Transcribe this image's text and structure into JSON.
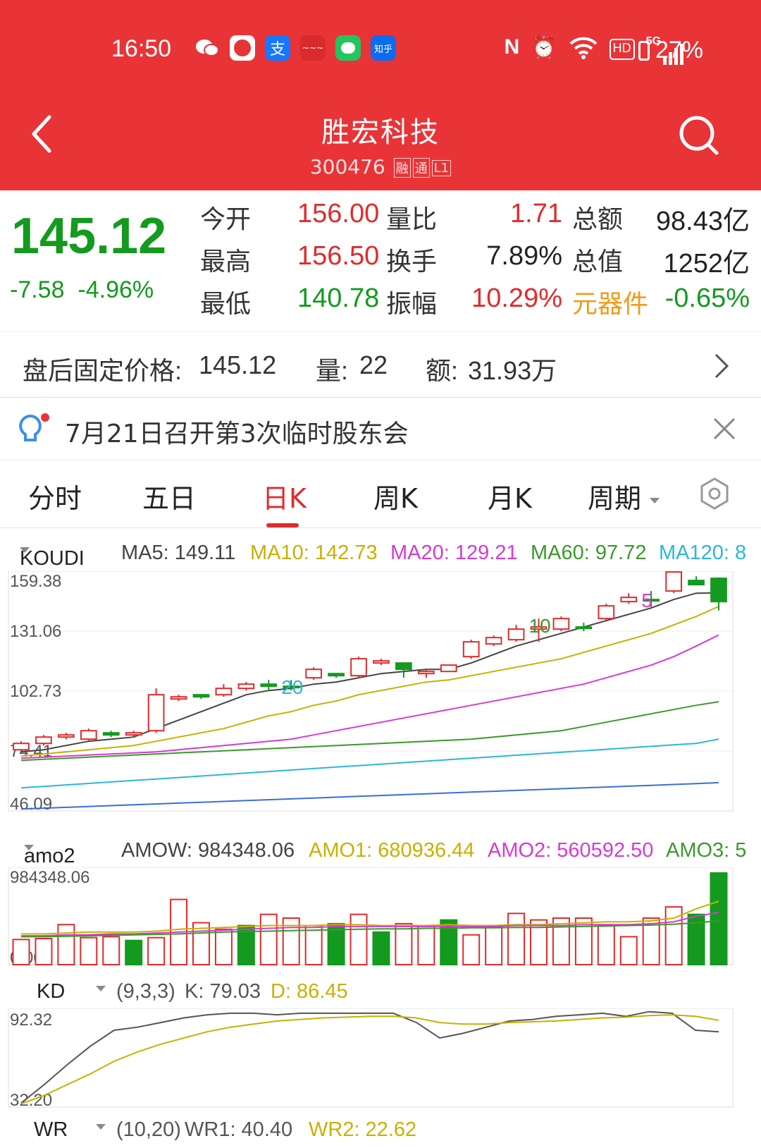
{
  "status_bar": {
    "time": "16:50",
    "battery": "27%",
    "icons": [
      "wechat-icon",
      "app-icon",
      "alipay-icon",
      "app-icon",
      "messages-icon",
      "zhihu-icon",
      "nfc-icon",
      "alarm-icon",
      "wifi-icon",
      "hd-icon",
      "5g-signal-icon",
      "battery-icon"
    ],
    "zhihu_label": "知乎",
    "hd_label": "HD",
    "net_label": "5G"
  },
  "header": {
    "title": "胜宏科技",
    "code": "300476",
    "tags": [
      "融",
      "通",
      "L1"
    ]
  },
  "quote": {
    "price": "145.12",
    "change": "-7.58",
    "change_pct": "-4.96%",
    "open_label": "今开",
    "open": "156.00",
    "high_label": "最高",
    "high": "156.50",
    "low_label": "最低",
    "low": "140.78",
    "vol_ratio_label": "量比",
    "vol_ratio": "1.71",
    "turnover_label": "换手",
    "turnover": "7.89%",
    "amplitude_label": "振幅",
    "amplitude": "10.29%",
    "amount_label": "总额",
    "amount": "98.43亿",
    "mktcap_label": "总值",
    "mktcap": "1252亿",
    "sector_label": "元器件",
    "sector_change": "-0.65%",
    "colors": {
      "up": "#e02b2b",
      "down": "#139a1f",
      "sector": "#f19b1a"
    }
  },
  "after_hours": {
    "label": "盘后固定价格:",
    "price": "145.12",
    "vol_label": "量:",
    "vol": "22",
    "amt_label": "额:",
    "amt": "31.93万"
  },
  "notice": {
    "text": "7月21日召开第3次临时股东会"
  },
  "tabs": {
    "items": [
      "分时",
      "五日",
      "日K",
      "周K",
      "月K",
      "周期"
    ],
    "active": "日K"
  },
  "main_legend": {
    "name": "KOUDI",
    "items": [
      {
        "label": "MA5: 149.11",
        "color": "#444444"
      },
      {
        "label": "MA10: 142.73",
        "color": "#c9b000"
      },
      {
        "label": "MA20: 129.21",
        "color": "#d63ad6"
      },
      {
        "label": "MA60: 97.72",
        "color": "#3a9a2a"
      },
      {
        "label": "MA120: 8",
        "color": "#2bb8d6"
      }
    ]
  },
  "amo_legend": {
    "name": "amo2",
    "items": [
      {
        "label": "AMOW: 984348.06",
        "color": "#444444"
      },
      {
        "label": "AMO1: 680936.44",
        "color": "#c9b000"
      },
      {
        "label": "AMO2: 560592.50",
        "color": "#d63ad6"
      },
      {
        "label": "AMO3: 5",
        "color": "#3a9a2a"
      }
    ]
  },
  "kd_legend": {
    "name": "KD",
    "params": "(9,3,3)",
    "k_label": "K: 79.03",
    "d_label": "D: 86.45"
  },
  "wr_legend": {
    "name": "WR",
    "params": "(10,20)",
    "wr1_label": "WR1: 40.40",
    "wr2_label": "WR2: 22.62"
  },
  "chart_data": [
    {
      "type": "candlestick",
      "title": "KOUDI",
      "ylim": [
        46.09,
        159.38
      ],
      "yticks": [
        "159.38",
        "131.06",
        "102.73",
        "74.41",
        "46.09"
      ],
      "markers": [
        "20",
        "10",
        "5"
      ],
      "candles": [
        {
          "o": 75,
          "c": 78,
          "h": 79,
          "l": 74,
          "up": true
        },
        {
          "o": 78,
          "c": 81,
          "h": 82,
          "l": 77,
          "up": true
        },
        {
          "o": 81,
          "c": 82,
          "h": 83,
          "l": 80,
          "up": true
        },
        {
          "o": 80,
          "c": 84,
          "h": 85,
          "l": 79,
          "up": true
        },
        {
          "o": 83,
          "c": 82,
          "h": 84,
          "l": 81,
          "up": false
        },
        {
          "o": 82,
          "c": 83,
          "h": 84,
          "l": 81,
          "up": true
        },
        {
          "o": 84,
          "c": 101,
          "h": 104,
          "l": 83,
          "up": true
        },
        {
          "o": 99,
          "c": 100,
          "h": 101,
          "l": 98,
          "up": true
        },
        {
          "o": 101,
          "c": 100,
          "h": 101,
          "l": 99,
          "up": false
        },
        {
          "o": 101,
          "c": 104,
          "h": 106,
          "l": 100,
          "up": true
        },
        {
          "o": 104,
          "c": 106,
          "h": 107,
          "l": 103,
          "up": true
        },
        {
          "o": 106,
          "c": 105,
          "h": 108,
          "l": 103,
          "up": false
        },
        {
          "o": 105,
          "c": 105,
          "h": 108,
          "l": 103,
          "up": false
        },
        {
          "o": 109,
          "c": 113,
          "h": 114,
          "l": 108,
          "up": true
        },
        {
          "o": 111,
          "c": 110,
          "h": 111,
          "l": 109,
          "up": false
        },
        {
          "o": 110,
          "c": 118,
          "h": 119,
          "l": 109,
          "up": true
        },
        {
          "o": 116,
          "c": 117,
          "h": 118,
          "l": 115,
          "up": true
        },
        {
          "o": 116,
          "c": 113,
          "h": 116,
          "l": 109,
          "up": false
        },
        {
          "o": 111,
          "c": 112,
          "h": 113,
          "l": 109,
          "up": true
        },
        {
          "o": 112,
          "c": 115,
          "h": 115,
          "l": 112,
          "up": true
        },
        {
          "o": 119,
          "c": 126,
          "h": 127,
          "l": 118,
          "up": true
        },
        {
          "o": 125,
          "c": 128,
          "h": 129,
          "l": 124,
          "up": true
        },
        {
          "o": 127,
          "c": 132,
          "h": 134,
          "l": 126,
          "up": true
        },
        {
          "o": 132,
          "c": 133,
          "h": 137,
          "l": 126,
          "up": true
        },
        {
          "o": 132,
          "c": 137,
          "h": 138,
          "l": 131,
          "up": true
        },
        {
          "o": 133,
          "c": 133,
          "h": 135,
          "l": 131,
          "up": false
        },
        {
          "o": 137,
          "c": 143,
          "h": 144,
          "l": 136,
          "up": true
        },
        {
          "o": 145,
          "c": 147,
          "h": 149,
          "l": 144,
          "up": true
        },
        {
          "o": 146,
          "c": 146,
          "h": 150,
          "l": 142,
          "up": false
        },
        {
          "o": 150,
          "c": 159,
          "h": 159,
          "l": 149,
          "up": true
        },
        {
          "o": 155,
          "c": 153,
          "h": 157,
          "l": 153,
          "up": false
        },
        {
          "o": 156,
          "c": 145,
          "h": 156.5,
          "l": 140.8,
          "up": false
        }
      ],
      "series": [
        {
          "name": "MA5",
          "color": "#444444",
          "values": [
            74,
            75,
            77,
            79,
            80,
            81,
            85,
            89,
            93,
            97,
            101,
            103,
            104,
            106,
            107,
            109,
            111,
            112,
            113,
            113,
            116,
            120,
            124,
            127,
            130,
            133,
            136,
            139,
            142,
            146,
            149,
            149.11
          ]
        },
        {
          "name": "MA10",
          "color": "#c9b000",
          "values": [
            72,
            73,
            74,
            75,
            76,
            77,
            79,
            81,
            83,
            85,
            88,
            91,
            93,
            96,
            98,
            101,
            103,
            105,
            107,
            108,
            110,
            112,
            114,
            116,
            118,
            121,
            124,
            127,
            130,
            134,
            138,
            142.73
          ]
        },
        {
          "name": "MA20",
          "color": "#d63ad6",
          "values": [
            71,
            71.5,
            72,
            72.5,
            73,
            73.5,
            74,
            75,
            76,
            77,
            78,
            79,
            80,
            82,
            84,
            86,
            88,
            90,
            92,
            94,
            96,
            98,
            100,
            102,
            104,
            106,
            109,
            112,
            115,
            119,
            124,
            129.21
          ]
        },
        {
          "name": "MA60",
          "color": "#3a9a2a",
          "values": [
            70,
            70.5,
            71,
            71.5,
            72,
            72.5,
            73,
            73.5,
            74,
            74.5,
            75,
            75.5,
            76,
            76.5,
            77,
            77.5,
            78,
            78.5,
            79,
            79.5,
            80,
            81,
            82,
            83,
            84,
            86,
            88,
            90,
            92,
            94,
            96,
            97.72
          ]
        },
        {
          "name": "MA120",
          "color": "#2bb8d6",
          "values": [
            57,
            57.7,
            58.4,
            59.1,
            59.8,
            60.5,
            61.2,
            61.9,
            62.6,
            63.3,
            64,
            64.7,
            65.4,
            66.1,
            66.8,
            67.5,
            68.2,
            68.9,
            69.6,
            70.3,
            71,
            71.7,
            72.4,
            73.1,
            73.8,
            74.5,
            75.2,
            75.9,
            76.6,
            77.3,
            78,
            80
          ]
        },
        {
          "name": "MA250",
          "color": "#3a6fd6",
          "values": [
            47,
            47.4,
            47.8,
            48.2,
            48.6,
            49,
            49.4,
            49.8,
            50.2,
            50.6,
            51,
            51.4,
            51.8,
            52.2,
            52.6,
            53,
            53.4,
            53.8,
            54.2,
            54.6,
            55,
            55.4,
            55.8,
            56.2,
            56.6,
            57,
            57.4,
            57.8,
            58.2,
            58.6,
            59,
            59.5
          ]
        }
      ]
    },
    {
      "type": "bar",
      "title": "amo2",
      "ylim": [
        0,
        984348.06
      ],
      "yticks": [
        "984348.06",
        "0.00"
      ],
      "values": [
        270000,
        280000,
        430000,
        290000,
        300000,
        260000,
        290000,
        700000,
        450000,
        380000,
        420000,
        540000,
        500000,
        420000,
        440000,
        540000,
        350000,
        440000,
        410000,
        480000,
        320000,
        400000,
        550000,
        480000,
        500000,
        500000,
        420000,
        300000,
        500000,
        620000,
        540000,
        984348
      ],
      "up": [
        true,
        true,
        true,
        true,
        true,
        false,
        true,
        true,
        true,
        true,
        false,
        true,
        true,
        true,
        false,
        true,
        false,
        true,
        true,
        false,
        true,
        true,
        true,
        true,
        true,
        true,
        true,
        true,
        true,
        true,
        false,
        false
      ],
      "series": [
        {
          "name": "AMO1",
          "color": "#c9b000",
          "values": [
            330000,
            330000,
            340000,
            350000,
            350000,
            350000,
            360000,
            380000,
            390000,
            400000,
            410000,
            420000,
            420000,
            420000,
            430000,
            430000,
            420000,
            420000,
            420000,
            430000,
            420000,
            420000,
            430000,
            430000,
            440000,
            450000,
            460000,
            460000,
            470000,
            500000,
            600000,
            680936
          ]
        },
        {
          "name": "AMO2",
          "color": "#d63ad6",
          "values": [
            310000,
            310000,
            320000,
            320000,
            330000,
            330000,
            340000,
            350000,
            360000,
            370000,
            380000,
            390000,
            400000,
            400000,
            410000,
            410000,
            410000,
            410000,
            410000,
            410000,
            410000,
            410000,
            420000,
            420000,
            420000,
            430000,
            430000,
            430000,
            440000,
            460000,
            520000,
            560592
          ]
        },
        {
          "name": "AMO3",
          "color": "#3a9a2a",
          "values": [
            300000,
            300000,
            305000,
            310000,
            315000,
            320000,
            325000,
            330000,
            340000,
            350000,
            355000,
            360000,
            365000,
            370000,
            375000,
            380000,
            385000,
            385000,
            390000,
            390000,
            395000,
            395000,
            400000,
            400000,
            405000,
            410000,
            415000,
            420000,
            425000,
            435000,
            450000,
            470000
          ]
        }
      ]
    },
    {
      "type": "line",
      "title": "KD",
      "ylim": [
        32.2,
        92.32
      ],
      "yticks": [
        "92.32",
        "32.20"
      ],
      "series": [
        {
          "name": "K",
          "color": "#555555",
          "values": [
            33,
            45,
            58,
            70,
            80,
            82,
            85,
            88,
            90,
            91,
            91,
            90,
            91,
            91,
            91,
            91,
            91,
            85,
            75,
            78,
            82,
            86,
            87,
            89,
            90,
            91,
            89,
            92,
            91,
            80,
            79.03
          ]
        },
        {
          "name": "D",
          "color": "#c9b000",
          "values": [
            32.5,
            38,
            45,
            52,
            60,
            66,
            71,
            75,
            79,
            82,
            84,
            86,
            87,
            88,
            88.5,
            89,
            89,
            88,
            85,
            84,
            84,
            85,
            85.5,
            86,
            87,
            88,
            88.5,
            89.5,
            90,
            89,
            86.45
          ]
        }
      ]
    }
  ]
}
